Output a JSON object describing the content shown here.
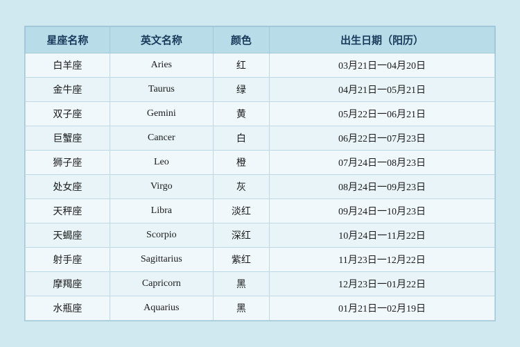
{
  "table": {
    "headers": {
      "chinese_name": "星座名称",
      "english_name": "英文名称",
      "color": "颜色",
      "birth_date": "出生日期（阳历）"
    },
    "rows": [
      {
        "chinese": "白羊座",
        "english": "Aries",
        "color": "红",
        "date": "03月21日一04月20日"
      },
      {
        "chinese": "金牛座",
        "english": "Taurus",
        "color": "绿",
        "date": "04月21日一05月21日"
      },
      {
        "chinese": "双子座",
        "english": "Gemini",
        "color": "黄",
        "date": "05月22日一06月21日"
      },
      {
        "chinese": "巨蟹座",
        "english": "Cancer",
        "color": "白",
        "date": "06月22日一07月23日"
      },
      {
        "chinese": "狮子座",
        "english": "Leo",
        "color": "橙",
        "date": "07月24日一08月23日"
      },
      {
        "chinese": "处女座",
        "english": "Virgo",
        "color": "灰",
        "date": "08月24日一09月23日"
      },
      {
        "chinese": "天秤座",
        "english": "Libra",
        "color": "淡红",
        "date": "09月24日一10月23日"
      },
      {
        "chinese": "天蝎座",
        "english": "Scorpio",
        "color": "深红",
        "date": "10月24日一11月22日"
      },
      {
        "chinese": "射手座",
        "english": "Sagittarius",
        "color": "紫红",
        "date": "11月23日一12月22日"
      },
      {
        "chinese": "摩羯座",
        "english": "Capricorn",
        "color": "黑",
        "date": "12月23日一01月22日"
      },
      {
        "chinese": "水瓶座",
        "english": "Aquarius",
        "color": "黑",
        "date": "01月21日一02月19日"
      }
    ]
  }
}
